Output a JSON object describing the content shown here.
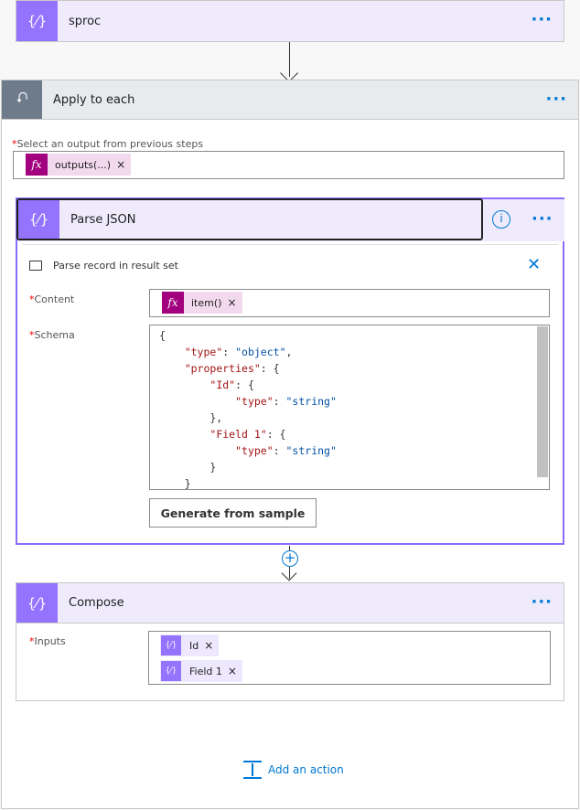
{
  "sproc": {
    "title": "sproc",
    "icon": "variable-icon",
    "more": "···"
  },
  "apply": {
    "title": "Apply to each",
    "icon": "loop-icon",
    "more": "···",
    "output_label": "Select an output from previous steps",
    "required": "*",
    "token": {
      "fx": "fx",
      "label": "outputs(...)",
      "remove": "×"
    }
  },
  "parse": {
    "title": "Parse JSON",
    "more": "···",
    "info": "i",
    "comment": "Parse record in result set",
    "close": "✕",
    "content_label": "Content",
    "schema_label": "Schema",
    "content_token": {
      "fx": "fx",
      "label": "item()",
      "remove": "×"
    },
    "schema_lines": [
      "{",
      "    \"type\": \"object\",",
      "    \"properties\": {",
      "        \"Id\": {",
      "            \"type\": \"string\"",
      "        },",
      "        \"Field 1\": {",
      "            \"type\": \"string\"",
      "        }",
      "    }"
    ],
    "generate": "Generate from sample"
  },
  "compose": {
    "title": "Compose",
    "more": "···",
    "inputs_label": "Inputs",
    "tokens": [
      {
        "icon": "{⁄}",
        "label": "Id",
        "remove": "×"
      },
      {
        "icon": "{⁄}",
        "label": "Field 1",
        "remove": "×"
      }
    ]
  },
  "add_action": "Add an action",
  "colors": {
    "accent": "#0078d4",
    "variable": "#9473ff",
    "expression": "#a2007e",
    "loop": "#6e7b8b"
  }
}
